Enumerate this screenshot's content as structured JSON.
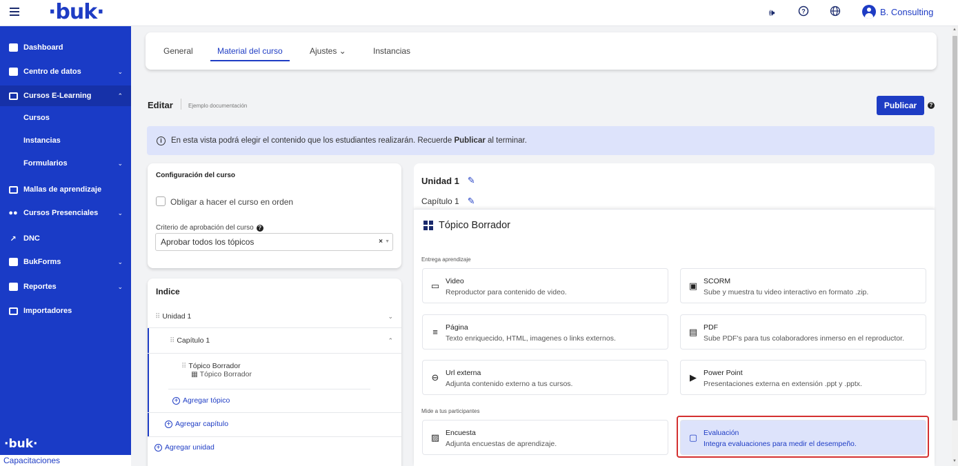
{
  "app": {
    "logo": "·buk·",
    "user_name": "B. Consulting"
  },
  "topbar_icons": [
    "megaphone-icon",
    "help-icon",
    "globe-icon"
  ],
  "sidebar": {
    "items": [
      {
        "label": "Dashboard",
        "icon": "dashboard-icon"
      },
      {
        "label": "Centro de datos",
        "icon": "database-icon"
      },
      {
        "label": "Cursos E-Learning",
        "icon": "play-icon"
      },
      {
        "label": "Mallas de aprendizaje",
        "icon": "book-icon"
      },
      {
        "label": "Cursos Presenciales",
        "icon": "people-icon"
      },
      {
        "label": "DNC",
        "icon": "chart-icon"
      },
      {
        "label": "BukForms",
        "icon": "clipboard-icon"
      },
      {
        "label": "Reportes",
        "icon": "report-icon"
      },
      {
        "label": "Importadores",
        "icon": "import-icon"
      }
    ],
    "subitems": [
      {
        "label": "Cursos"
      },
      {
        "label": "Instancias"
      },
      {
        "label": "Formularios"
      }
    ],
    "footer_logo": "·buk·",
    "footer_text": "Capacitaciones"
  },
  "tabs": [
    {
      "label": "General"
    },
    {
      "label": "Material del curso"
    },
    {
      "label": "Ajustes ⌄"
    },
    {
      "label": "Instancias"
    }
  ],
  "editor": {
    "title": "Editar",
    "subtitle": "Ejemplo documentación",
    "publish_label": "Publicar"
  },
  "info": {
    "text_before": "En esta vista podrá elegir el contenido que los estudiantes realizarán. Recuerde",
    "bold_word": "Publicar",
    "text_after": "al terminar."
  },
  "config": {
    "title": "Configuración del curso",
    "checkbox_label": "Obligar a hacer el curso en orden",
    "criteria_label": "Criterio de aprobación del curso",
    "criteria_value": "Aprobar todos los tópicos"
  },
  "index": {
    "title": "Indice",
    "unit": "Unidad 1",
    "chapter": "Capítulo 1",
    "topic": "Tópico Borrador",
    "topic_sub": "Tópico Borrador",
    "add_topic": "Agregar tópico",
    "add_chapter": "Agregar capítulo",
    "add_unit": "Agregar unidad"
  },
  "content": {
    "unit_title": "Unidad 1",
    "chapter_title": "Capítulo 1",
    "topic_title": "Tópico Borrador",
    "section1": "Entrega aprendizaje",
    "section2": "Mide a tus participantes",
    "options": [
      {
        "title": "Video",
        "desc": "Reproductor para contenido de video.",
        "icon": "video-icon"
      },
      {
        "title": "SCORM",
        "desc": "Sube y muestra tu video interactivo en formato .zip.",
        "icon": "scorm-icon"
      },
      {
        "title": "Página",
        "desc": "Texto enriquecido, HTML, imagenes o links externos.",
        "icon": "page-icon"
      },
      {
        "title": "PDF",
        "desc": "Sube PDF's para tus colaboradores inmerso en el reproductor.",
        "icon": "pdf-icon"
      },
      {
        "title": "Url externa",
        "desc": "Adjunta contenido externo a tus cursos.",
        "icon": "link-icon"
      },
      {
        "title": "Power Point",
        "desc": "Presentaciones externa en extensión .ppt y .pptx.",
        "icon": "slideshow-icon"
      },
      {
        "title": "Encuesta",
        "desc": "Adjunta encuestas de aprendizaje.",
        "icon": "survey-icon"
      },
      {
        "title": "Evaluación",
        "desc": "Integra evaluaciones para medir el desempeño.",
        "icon": "evaluation-icon"
      }
    ]
  },
  "colors": {
    "primary": "#1e3cc4",
    "sidebar": "#1a3bc6",
    "info_bg": "#dde3fb",
    "highlight": "#d32f2f"
  }
}
